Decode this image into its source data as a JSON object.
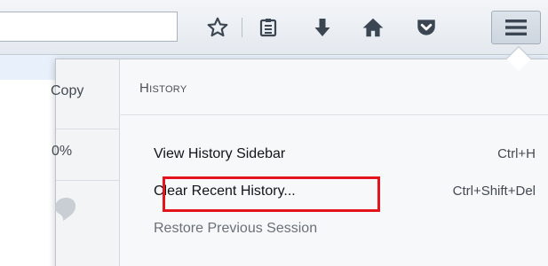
{
  "toolbar": {
    "url_value": "",
    "icons": [
      "bookmark-star-icon",
      "reading-list-icon",
      "downloads-icon",
      "home-icon",
      "pocket-icon"
    ],
    "menu_button_icon": "hamburger-menu-icon"
  },
  "panel_left": {
    "copy_label": "Copy",
    "zoom_label": "0%"
  },
  "history": {
    "header": "History",
    "items": [
      {
        "label": "View History Sidebar",
        "shortcut": "Ctrl+H"
      },
      {
        "label": "Clear Recent History...",
        "shortcut": "Ctrl+Shift+Del"
      },
      {
        "label": "Restore Previous Session",
        "shortcut": ""
      }
    ]
  },
  "colors": {
    "highlight": "#e3141b",
    "toolbar_bg": "#e4e9ef",
    "icon": "#3b4652"
  }
}
